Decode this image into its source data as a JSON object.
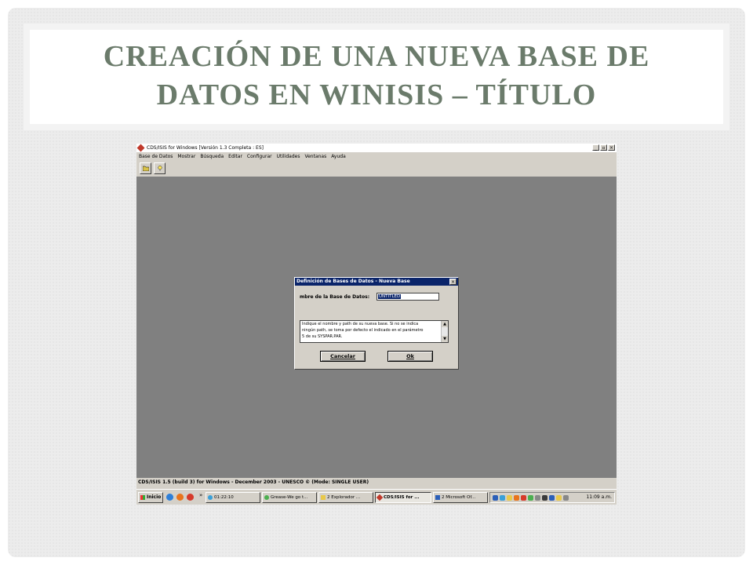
{
  "slide": {
    "title_line1": "CREACIÓN DE UNA NUEVA BASE DE",
    "title_line2": "DATOS EN WINISIS – TÍTULO"
  },
  "app": {
    "window_title": "CDS/ISIS for Windows [Versión 1.3 Completa : ES]",
    "window_controls": [
      "_",
      "▫",
      "×"
    ],
    "menu": [
      "Base de Datos",
      "Mostrar",
      "Búsqueda",
      "Editar",
      "Configurar",
      "Utilidades",
      "Ventanas",
      "Ayuda"
    ],
    "toolbar_icons": [
      "open-folder-icon",
      "lightbulb-icon"
    ],
    "status_text": "CDS/ISIS 1.5 (build 3) for Windows - December 2003 - UNESCO © (Mode: SINGLE USER)"
  },
  "dialog": {
    "title": "Definición de Bases de Datos - Nueva Base",
    "close": "×",
    "label": "mbre de la Base de Datos:",
    "input_value": "UNTITLED",
    "help_lines": [
      "Indique el nombre y path de su nueva base. Si no se indica",
      "ningún path, se toma por defecto el indicado en el parámetro",
      "5 de su SYSPAR.PAR."
    ],
    "cancel_label": "Cancelar",
    "ok_label": "Ok"
  },
  "taskbar": {
    "start_label": "Inicio",
    "quicklaunch_more": "»",
    "tasks": [
      {
        "label": "01:22:10",
        "active": false
      },
      {
        "label": "Grease-We go t...",
        "active": false
      },
      {
        "label": "2 Explorador ...",
        "active": false
      },
      {
        "label": "CDS/ISIS for ...",
        "active": true
      },
      {
        "label": "2 Microsoft Of...",
        "active": false
      }
    ],
    "clock": "11:09 a.m."
  },
  "colors": {
    "title_text": "#6b7b6b",
    "workspace": "#808080",
    "dialog_titlebar": "#0a246a"
  }
}
